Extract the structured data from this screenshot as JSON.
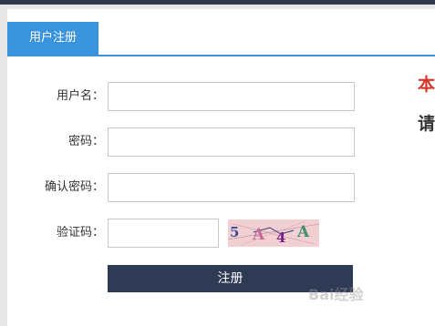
{
  "tab": {
    "label": "用户注册"
  },
  "form": {
    "username_label": "用户名：",
    "password_label": "密码：",
    "confirm_password_label": "确认密码：",
    "captcha_label": "验证码：",
    "username_value": "",
    "password_value": "",
    "confirm_password_value": "",
    "captcha_value": "",
    "captcha_image_text": "5A4A",
    "submit_label": "注册"
  },
  "side": {
    "line1": "本",
    "line2": "请"
  },
  "watermark": {
    "text": "Bai经验"
  },
  "colors": {
    "tab_accent": "#3a94dd",
    "button_bg": "#2f3a55",
    "highlight_red": "#d9342b"
  }
}
